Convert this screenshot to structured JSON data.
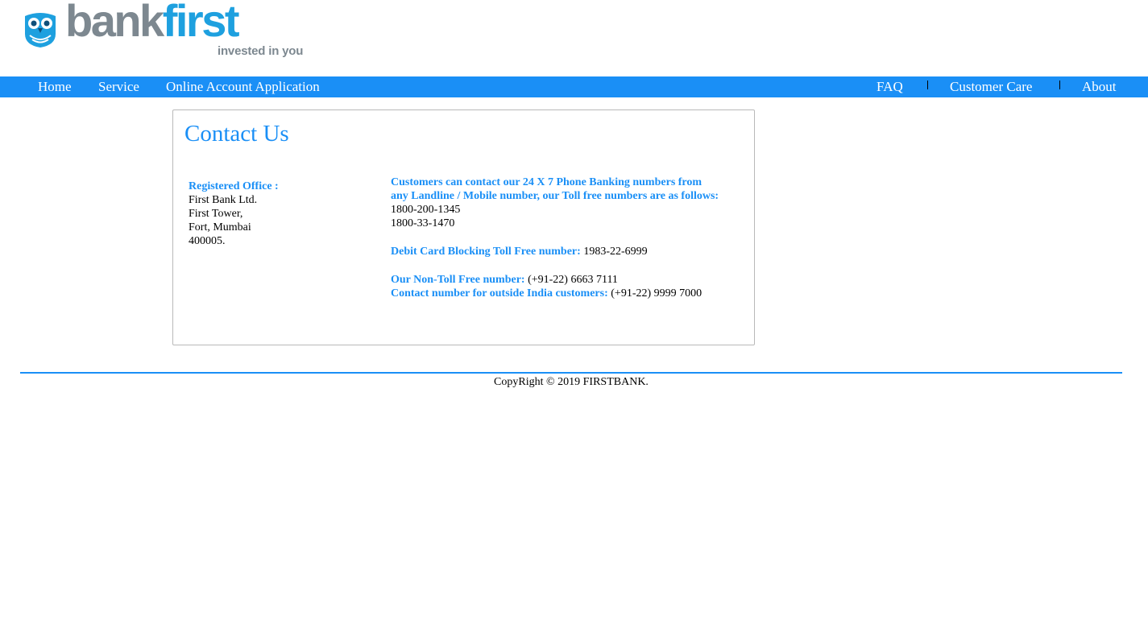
{
  "brand": {
    "word_gray": "bank",
    "word_blue": "first",
    "tagline": "invested in you",
    "colors": {
      "gray": "#7d8890",
      "blue": "#1ea0df"
    }
  },
  "nav": {
    "left": [
      {
        "label": "Home"
      },
      {
        "label": "Service"
      },
      {
        "label": "Online Account Application"
      }
    ],
    "right": [
      {
        "label": "FAQ"
      },
      {
        "label": "Customer Care"
      },
      {
        "label": "About"
      }
    ],
    "background": "#1a8ff6"
  },
  "page": {
    "title": "Contact Us"
  },
  "office": {
    "heading": "Registered Office :",
    "lines": [
      "First Bank Ltd.",
      "First Tower,",
      "Fort, Mumbai",
      "400005."
    ]
  },
  "contact": {
    "intro": "Customers can contact our 24 X 7 Phone Banking numbers from any Landline / Mobile number, our Toll free numbers are as follows:",
    "toll_free": [
      "1800-200-1345",
      "1800-33-1470"
    ],
    "debit_label": "Debit Card Blocking Toll Free number:",
    "debit_value": "1983-22-6999",
    "nontoll_label": "Our Non-Toll Free number:",
    "nontoll_value": "(+91-22) 6663 7111",
    "outside_label": "Contact number for outside India customers:",
    "outside_value": "(+91-22) 9999 7000"
  },
  "footer": {
    "copyright": "CopyRight © 2019 FIRSTBANK."
  },
  "theme": {
    "accent": "#1a8ff6"
  }
}
